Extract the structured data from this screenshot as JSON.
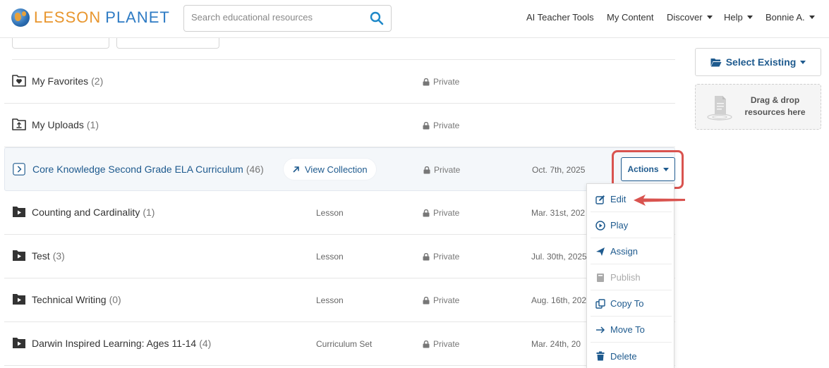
{
  "header": {
    "logo_lesson": "LESSON",
    "logo_planet": "PLANET",
    "search_placeholder": "Search educational resources",
    "nav": [
      {
        "label": "AI Teacher Tools"
      },
      {
        "label": "My Content"
      },
      {
        "label": "Discover"
      },
      {
        "label": "Help"
      },
      {
        "label": "Bonnie A."
      }
    ]
  },
  "rows": [
    {
      "title": "My Favorites",
      "count": "(2)",
      "type": "",
      "privacy": "Private",
      "date": "",
      "icon": "heart-folder-icon"
    },
    {
      "title": "My Uploads",
      "count": "(1)",
      "type": "",
      "privacy": "Private",
      "date": "",
      "icon": "upload-folder-icon"
    },
    {
      "title": "Core Knowledge Second Grade ELA Curriculum",
      "count": "(46)",
      "type": "",
      "privacy": "Private",
      "date": "Oct. 7th, 2025",
      "icon": "chevron-right-icon",
      "view_label": "View Collection",
      "actions_label": "Actions"
    },
    {
      "title": "Counting and Cardinality",
      "count": "(1)",
      "type": "Lesson",
      "privacy": "Private",
      "date": "Mar. 31st, 202",
      "icon": "play-folder-icon"
    },
    {
      "title": "Test",
      "count": "(3)",
      "type": "Lesson",
      "privacy": "Private",
      "date": "Jul. 30th, 2025",
      "icon": "play-folder-icon"
    },
    {
      "title": "Technical Writing",
      "count": "(0)",
      "type": "Lesson",
      "privacy": "Private",
      "date": "Aug. 16th, 202",
      "icon": "play-folder-icon"
    },
    {
      "title": "Darwin Inspired Learning: Ages 11-14",
      "count": "(4)",
      "type": "Curriculum Set",
      "privacy": "Private",
      "date": "Mar. 24th, 20",
      "icon": "play-folder-icon"
    }
  ],
  "dropdown": [
    {
      "label": "Edit",
      "icon": "edit-icon",
      "disabled": false
    },
    {
      "label": "Play",
      "icon": "play-circle-icon",
      "disabled": false
    },
    {
      "label": "Assign",
      "icon": "send-icon",
      "disabled": false
    },
    {
      "label": "Publish",
      "icon": "book-icon",
      "disabled": true
    },
    {
      "label": "Copy To",
      "icon": "copy-icon",
      "disabled": false
    },
    {
      "label": "Move To",
      "icon": "arrow-right-icon",
      "disabled": false
    },
    {
      "label": "Delete",
      "icon": "trash-icon",
      "disabled": false
    }
  ],
  "sidebar": {
    "select_existing": "Select Existing",
    "dropzone_text": "Drag & drop resources here"
  },
  "colors": {
    "brand_blue": "#1e5a8e",
    "logo_orange": "#e8962e",
    "logo_blue": "#2e7bc4",
    "highlight_red": "#d9534f"
  }
}
